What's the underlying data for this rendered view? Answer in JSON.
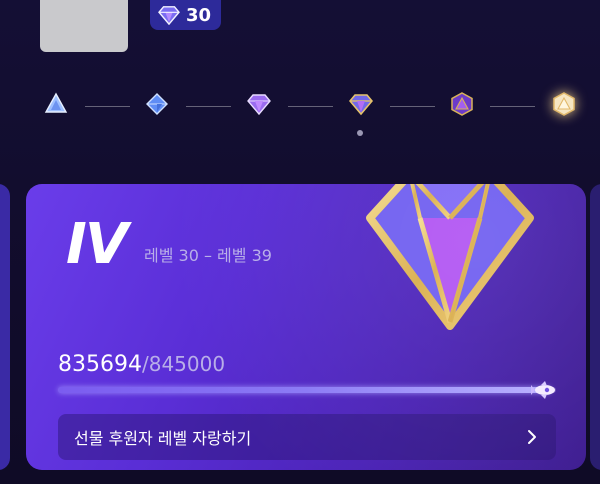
{
  "header": {
    "gem_count": "30",
    "gem_icon": "purple-diamond-icon"
  },
  "tier_track": {
    "tiers": [
      {
        "icon": "tier-1-gem-icon",
        "color": "#8fb4ff"
      },
      {
        "icon": "tier-2-gem-icon",
        "color": "#5f8df5"
      },
      {
        "icon": "tier-3-gem-icon",
        "color": "#a06cf0"
      },
      {
        "icon": "tier-4-gem-icon",
        "color": "#c9a14a"
      },
      {
        "icon": "tier-5-gem-icon",
        "color": "#d4a94e"
      },
      {
        "icon": "tier-6-gem-icon",
        "color": "#f2d9a8"
      }
    ],
    "current_index": 3
  },
  "card": {
    "tier_roman": "IV",
    "level_range": "레벨 30 – 레벨 39",
    "gem_icon": "tier-iv-diamond-icon",
    "score_current": "835694",
    "score_separator": "/",
    "score_target": "845000",
    "progress_fraction": 0.989,
    "cta_label": "선물 후원자 레벨 자랑하기",
    "cta_icon": "chevron-right-icon"
  },
  "colors": {
    "background": "#140f35",
    "card_start": "#6a3dea",
    "card_end": "#3d1c8f",
    "gold": "#e6c36a",
    "badge": "#2d2a9a"
  }
}
